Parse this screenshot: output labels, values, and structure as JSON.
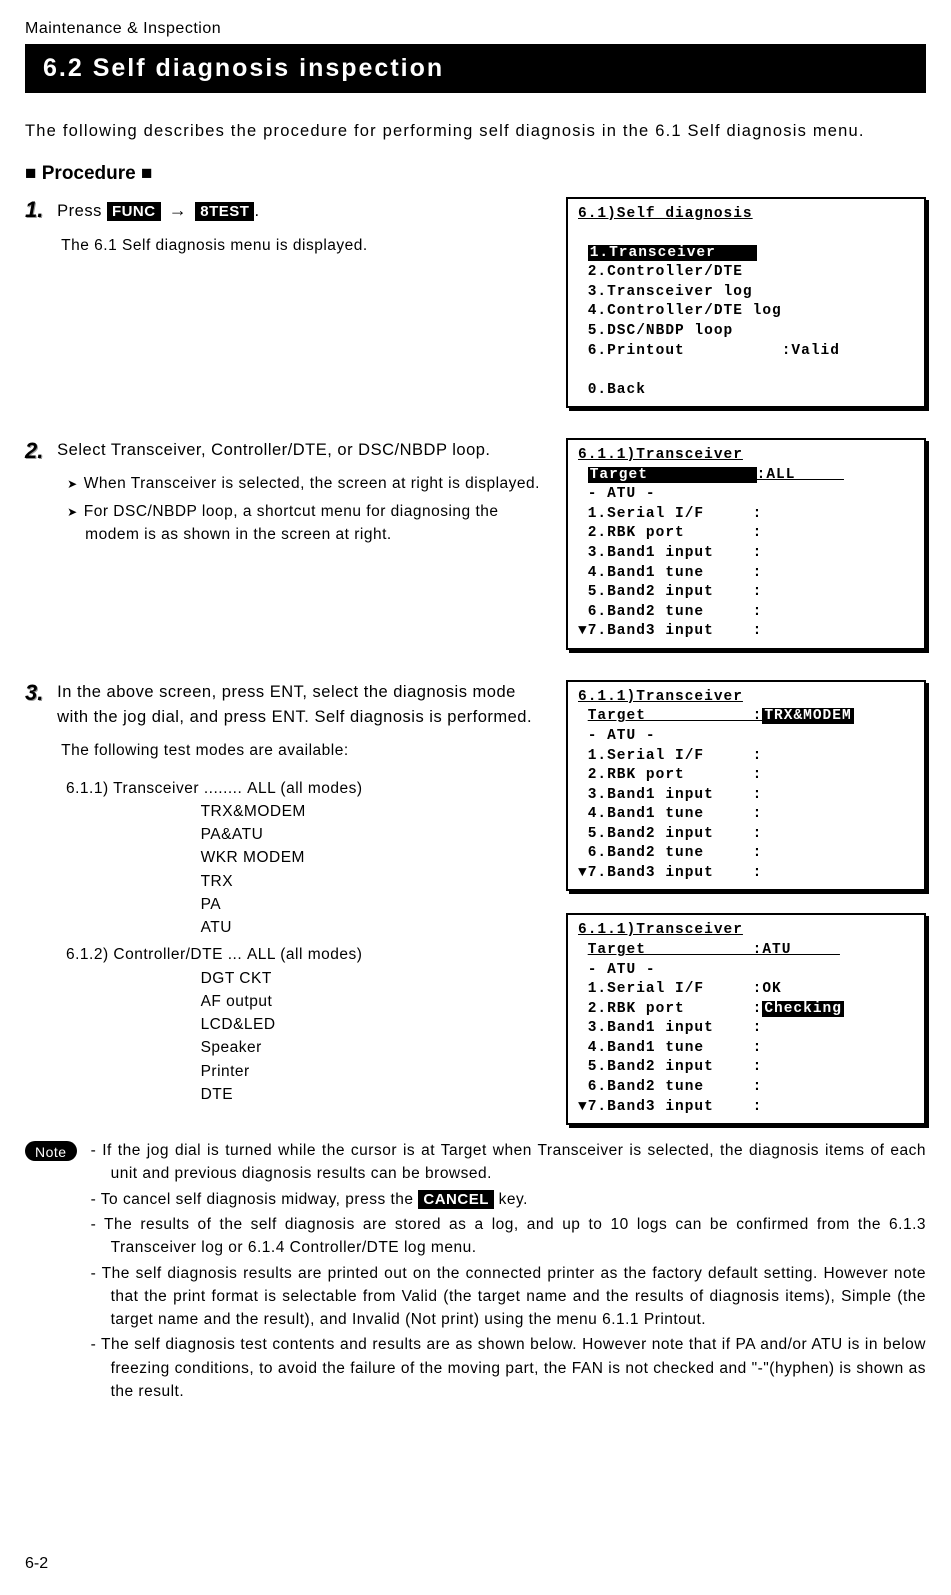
{
  "header_path": "Maintenance & Inspection",
  "title": "6.2   Self diagnosis inspection",
  "intro": "The following describes the procedure for performing self diagnosis in the 6.1 Self diagnosis menu.",
  "procedure_heading": "■ Procedure ■",
  "steps": {
    "1": {
      "num": "1.",
      "text_pre": "Press ",
      "key1": "FUNC",
      "arrow": "→",
      "key2": "8TEST",
      "text_post": ".",
      "sub": "The 6.1 Self diagnosis menu is displayed."
    },
    "2": {
      "num": "2.",
      "text": "Select Transceiver, Controller/DTE, or DSC/NBDP loop.",
      "bullets": [
        "When Transceiver is selected, the screen at right is displayed.",
        "For DSC/NBDP loop, a shortcut menu for diagnosing the modem is as shown in the screen at right."
      ]
    },
    "3": {
      "num": "3.",
      "text": "In the above screen, press ENT, select the diagnosis mode with the jog dial, and press ENT. Self diagnosis is performed.",
      "sub": "The following test modes are available:",
      "modes": {
        "a_label": "6.1.1) Transceiver ........",
        "a_values": [
          "ALL (all modes)",
          "TRX&MODEM",
          "PA&ATU",
          "WKR MODEM",
          "TRX",
          "PA",
          "ATU"
        ],
        "b_label": "6.1.2) Controller/DTE ...",
        "b_values": [
          "ALL (all modes)",
          "DGT CKT",
          "AF output",
          "LCD&LED",
          "Speaker",
          "Printer",
          "DTE"
        ]
      }
    }
  },
  "screens": {
    "s1": {
      "title": "6.1)Self diagnosis",
      "lines": [
        {
          "t": "1.Transceiver    ",
          "hi": true
        },
        {
          "t": "2.Controller/DTE"
        },
        {
          "t": "3.Transceiver log"
        },
        {
          "t": "4.Controller/DTE log"
        },
        {
          "t": "5.DSC/NBDP loop"
        },
        {
          "t": "6.Printout          :Valid"
        },
        {
          "t": ""
        },
        {
          "t": "0.Back"
        }
      ]
    },
    "s2": {
      "title": "6.1.1)Transceiver",
      "target_label": "Target           ",
      "target_hi": false,
      "target_val": ":ALL     ",
      "lines": [
        "- ATU -",
        "1.Serial I/F     :",
        "2.RBK port       :",
        "3.Band1 input    :",
        "4.Band1 tune     :",
        "5.Band2 input    :",
        "6.Band2 tune     :",
        "7.Band3 input    :"
      ]
    },
    "s3": {
      "title": "6.1.1)Transceiver",
      "target_label": "Target           ",
      "target_val_hi": "TRX&MODEM",
      "lines": [
        "- ATU -",
        "1.Serial I/F     :",
        "2.RBK port       :",
        "3.Band1 input    :",
        "4.Band1 tune     :",
        "5.Band2 input    :",
        "6.Band2 tune     :",
        "7.Band3 input    :"
      ]
    },
    "s4": {
      "title": "6.1.1)Transceiver",
      "target_label": "Target           ",
      "target_val": ":ATU     ",
      "lines": [
        "- ATU -",
        "1.Serial I/F     :OK",
        {
          "pre": "2.RBK port       :",
          "hi": "Checking"
        },
        "3.Band1 input    :",
        "4.Band1 tune     :",
        "5.Band2 input    :",
        "6.Band2 tune     :",
        "7.Band3 input    :"
      ]
    }
  },
  "note_label": "Note",
  "notes": [
    "If the jog dial is turned while the cursor is at Target when Transceiver is selected, the diagnosis items of each unit and previous diagnosis results can be browsed.",
    {
      "pre": "To cancel self diagnosis midway, press the ",
      "key": "CANCEL",
      "post": " key."
    },
    "The results of the self diagnosis are stored as a log, and up to 10 logs can be confirmed from the 6.1.3 Transceiver log or 6.1.4 Controller/DTE log menu.",
    "The self diagnosis results are printed out on the connected printer as the factory default setting. However note that the print format is selectable from Valid (the target name and the results of diagnosis items), Simple (the target name and the result), and Invalid (Not print) using the menu 6.1.1 Printout.",
    "The self diagnosis test contents and results are as shown below. However note that if PA and/or ATU is in below freezing conditions, to avoid the failure of the moving part, the FAN is not checked and \"-\"(hyphen) is shown as the result."
  ],
  "page_num": "6-2"
}
